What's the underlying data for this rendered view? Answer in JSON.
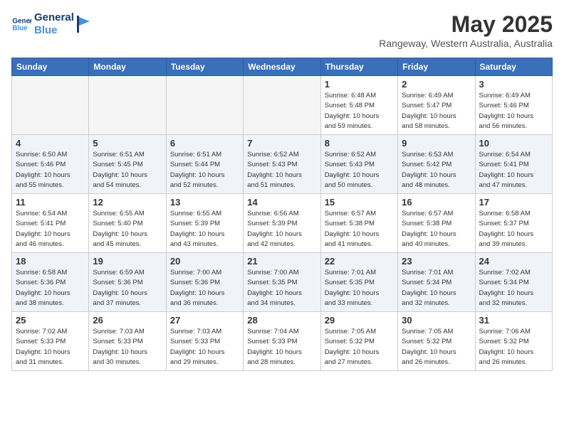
{
  "header": {
    "logo_line1": "General",
    "logo_line2": "Blue",
    "month": "May 2025",
    "location": "Rangeway, Western Australia, Australia"
  },
  "days_of_week": [
    "Sunday",
    "Monday",
    "Tuesday",
    "Wednesday",
    "Thursday",
    "Friday",
    "Saturday"
  ],
  "weeks": [
    [
      {
        "day": "",
        "info": ""
      },
      {
        "day": "",
        "info": ""
      },
      {
        "day": "",
        "info": ""
      },
      {
        "day": "",
        "info": ""
      },
      {
        "day": "1",
        "info": "Sunrise: 6:48 AM\nSunset: 5:48 PM\nDaylight: 10 hours\nand 59 minutes."
      },
      {
        "day": "2",
        "info": "Sunrise: 6:49 AM\nSunset: 5:47 PM\nDaylight: 10 hours\nand 58 minutes."
      },
      {
        "day": "3",
        "info": "Sunrise: 6:49 AM\nSunset: 5:46 PM\nDaylight: 10 hours\nand 56 minutes."
      }
    ],
    [
      {
        "day": "4",
        "info": "Sunrise: 6:50 AM\nSunset: 5:46 PM\nDaylight: 10 hours\nand 55 minutes."
      },
      {
        "day": "5",
        "info": "Sunrise: 6:51 AM\nSunset: 5:45 PM\nDaylight: 10 hours\nand 54 minutes."
      },
      {
        "day": "6",
        "info": "Sunrise: 6:51 AM\nSunset: 5:44 PM\nDaylight: 10 hours\nand 52 minutes."
      },
      {
        "day": "7",
        "info": "Sunrise: 6:52 AM\nSunset: 5:43 PM\nDaylight: 10 hours\nand 51 minutes."
      },
      {
        "day": "8",
        "info": "Sunrise: 6:52 AM\nSunset: 5:43 PM\nDaylight: 10 hours\nand 50 minutes."
      },
      {
        "day": "9",
        "info": "Sunrise: 6:53 AM\nSunset: 5:42 PM\nDaylight: 10 hours\nand 48 minutes."
      },
      {
        "day": "10",
        "info": "Sunrise: 6:54 AM\nSunset: 5:41 PM\nDaylight: 10 hours\nand 47 minutes."
      }
    ],
    [
      {
        "day": "11",
        "info": "Sunrise: 6:54 AM\nSunset: 5:41 PM\nDaylight: 10 hours\nand 46 minutes."
      },
      {
        "day": "12",
        "info": "Sunrise: 6:55 AM\nSunset: 5:40 PM\nDaylight: 10 hours\nand 45 minutes."
      },
      {
        "day": "13",
        "info": "Sunrise: 6:55 AM\nSunset: 5:39 PM\nDaylight: 10 hours\nand 43 minutes."
      },
      {
        "day": "14",
        "info": "Sunrise: 6:56 AM\nSunset: 5:39 PM\nDaylight: 10 hours\nand 42 minutes."
      },
      {
        "day": "15",
        "info": "Sunrise: 6:57 AM\nSunset: 5:38 PM\nDaylight: 10 hours\nand 41 minutes."
      },
      {
        "day": "16",
        "info": "Sunrise: 6:57 AM\nSunset: 5:38 PM\nDaylight: 10 hours\nand 40 minutes."
      },
      {
        "day": "17",
        "info": "Sunrise: 6:58 AM\nSunset: 5:37 PM\nDaylight: 10 hours\nand 39 minutes."
      }
    ],
    [
      {
        "day": "18",
        "info": "Sunrise: 6:58 AM\nSunset: 5:36 PM\nDaylight: 10 hours\nand 38 minutes."
      },
      {
        "day": "19",
        "info": "Sunrise: 6:59 AM\nSunset: 5:36 PM\nDaylight: 10 hours\nand 37 minutes."
      },
      {
        "day": "20",
        "info": "Sunrise: 7:00 AM\nSunset: 5:36 PM\nDaylight: 10 hours\nand 36 minutes."
      },
      {
        "day": "21",
        "info": "Sunrise: 7:00 AM\nSunset: 5:35 PM\nDaylight: 10 hours\nand 34 minutes."
      },
      {
        "day": "22",
        "info": "Sunrise: 7:01 AM\nSunset: 5:35 PM\nDaylight: 10 hours\nand 33 minutes."
      },
      {
        "day": "23",
        "info": "Sunrise: 7:01 AM\nSunset: 5:34 PM\nDaylight: 10 hours\nand 32 minutes."
      },
      {
        "day": "24",
        "info": "Sunrise: 7:02 AM\nSunset: 5:34 PM\nDaylight: 10 hours\nand 32 minutes."
      }
    ],
    [
      {
        "day": "25",
        "info": "Sunrise: 7:02 AM\nSunset: 5:33 PM\nDaylight: 10 hours\nand 31 minutes."
      },
      {
        "day": "26",
        "info": "Sunrise: 7:03 AM\nSunset: 5:33 PM\nDaylight: 10 hours\nand 30 minutes."
      },
      {
        "day": "27",
        "info": "Sunrise: 7:03 AM\nSunset: 5:33 PM\nDaylight: 10 hours\nand 29 minutes."
      },
      {
        "day": "28",
        "info": "Sunrise: 7:04 AM\nSunset: 5:33 PM\nDaylight: 10 hours\nand 28 minutes."
      },
      {
        "day": "29",
        "info": "Sunrise: 7:05 AM\nSunset: 5:32 PM\nDaylight: 10 hours\nand 27 minutes."
      },
      {
        "day": "30",
        "info": "Sunrise: 7:05 AM\nSunset: 5:32 PM\nDaylight: 10 hours\nand 26 minutes."
      },
      {
        "day": "31",
        "info": "Sunrise: 7:06 AM\nSunset: 5:32 PM\nDaylight: 10 hours\nand 26 minutes."
      }
    ]
  ]
}
